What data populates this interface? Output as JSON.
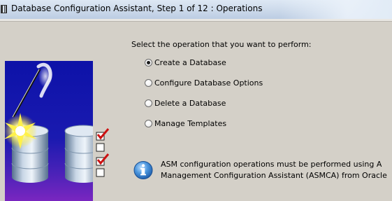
{
  "window": {
    "title": "Database Configuration Assistant, Step 1 of 12 : Operations"
  },
  "main": {
    "prompt": "Select the operation that you want to perform:",
    "operations": [
      {
        "label": "Create a Database",
        "selected": true
      },
      {
        "label": "Configure Database Options",
        "selected": false
      },
      {
        "label": "Delete a Database",
        "selected": false
      },
      {
        "label": "Manage Templates",
        "selected": false
      }
    ],
    "info": {
      "line1": "ASM configuration operations must be performed using A",
      "line2": "Management Configuration Assistant (ASMCA) from Oracle"
    }
  },
  "icons": {
    "window_icon": "application-icon",
    "graphic": "database-wizard-graphic",
    "info": "info-icon"
  },
  "colors": {
    "panel_blue": "#1a1aa6",
    "panel_purple": "#6a1fb0",
    "check_red": "#cc1111",
    "info_blue": "#2e78c8",
    "background": "#d4d0c8"
  }
}
